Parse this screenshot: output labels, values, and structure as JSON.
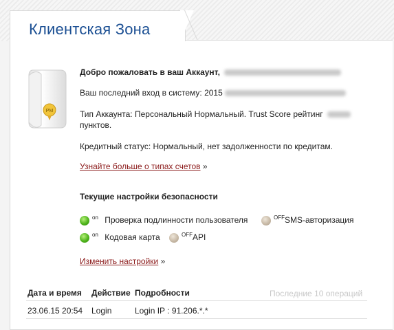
{
  "page": {
    "title": "Клиентская Зона"
  },
  "account": {
    "welcome_label": "Добро пожаловать в ваш Аккаунт,",
    "last_login_label": "Ваш последний вход в систему: 2015",
    "type_line1": "Тип Аккаунта: Персональный Нормальный. Trust Score рейтинг",
    "type_line2": "пунктов.",
    "credit_status": "Кредитный статус: Нормальный, нет задолженности по кредитам.",
    "learn_more_link": "Узнайте больше о типах счетов",
    "raquo": "»"
  },
  "security": {
    "heading": "Текущие настройки безопасности",
    "items": [
      {
        "label": "Проверка подлинности пользователя",
        "state": "on"
      },
      {
        "label": "SMS-авторизация",
        "state": "OFF"
      },
      {
        "label": "Кодовая карта",
        "state": "on"
      },
      {
        "label": "API",
        "state": "OFF"
      }
    ],
    "change_link": "Изменить настройки",
    "raquo": "»"
  },
  "operations": {
    "columns": [
      "Дата и время",
      "Действие",
      "Подробности"
    ],
    "recent_label": "Последние 10 операций",
    "rows": [
      {
        "datetime": "23.06.15 20:54",
        "action": "Login",
        "details": "Login IP : 91.206.*.*"
      }
    ]
  },
  "colors": {
    "title_blue": "#1b4f93",
    "link_red": "#8b1a1a",
    "on_green": "#4fb41c",
    "off_beige": "#c9bba8"
  }
}
